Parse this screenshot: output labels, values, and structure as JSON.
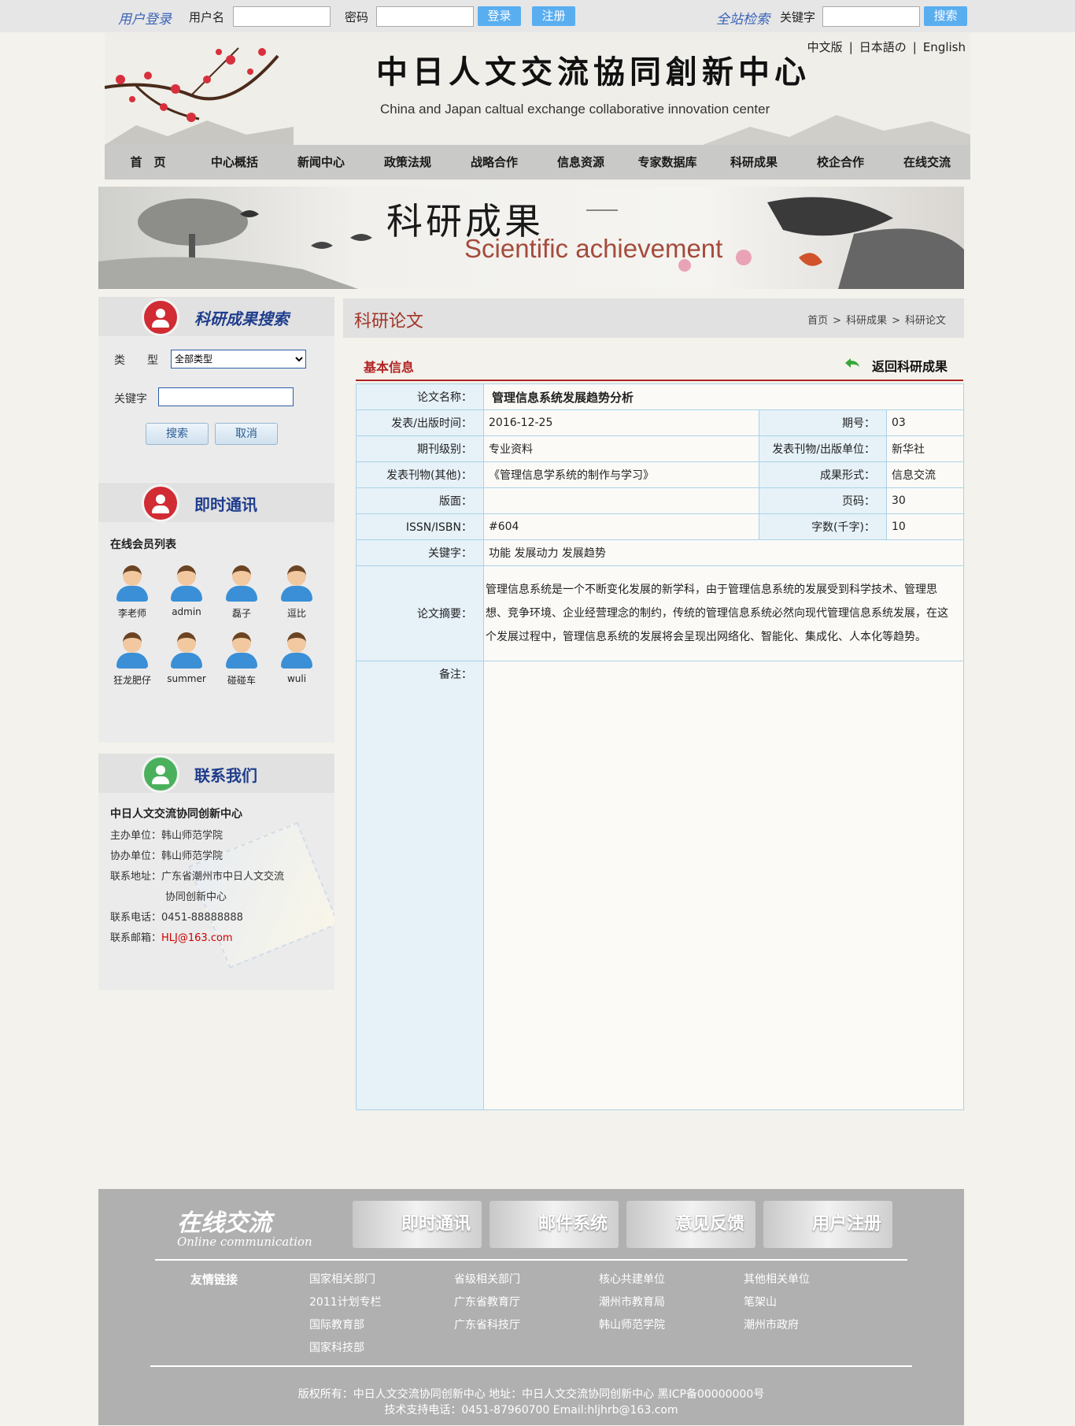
{
  "topbar": {
    "login_title": "用户登录",
    "username_label": "用户名",
    "username_value": "",
    "password_label": "密码",
    "password_value": "",
    "login_btn": "登录",
    "register_btn": "注册",
    "search_title": "全站检索",
    "keyword_label": "关键字",
    "keyword_value": "",
    "search_btn": "搜索"
  },
  "header": {
    "logo_cn": "中日人文交流協同創新中心",
    "logo_en": "China and Japan caltual exchange collaborative innovation center",
    "lang": [
      "中文版",
      "|",
      "日本語の",
      "|",
      "English"
    ]
  },
  "nav": [
    "首　页",
    "中心概括",
    "新闻中心",
    "政策法规",
    "战略合作",
    "信息资源",
    "专家数据库",
    "科研成果",
    "校企合作",
    "在线交流"
  ],
  "banner": {
    "cn": "科研成果",
    "en": "Scientific achievement"
  },
  "search_panel": {
    "title": "科研成果搜索",
    "type_label": "类　　型",
    "type_selected": "全部类型",
    "keyword_label": "关键字",
    "keyword_value": "",
    "search_btn": "搜索",
    "cancel_btn": "取消"
  },
  "im_panel": {
    "title": "即时通讯",
    "list_title": "在线会员列表",
    "members": [
      "李老师",
      "admin",
      "磊子",
      "逗比",
      "狂龙肥仔",
      "summer",
      "碰碰车",
      "wuli"
    ]
  },
  "contact_panel": {
    "title": "联系我们",
    "org": "中日人文交流协同创新中心",
    "host": "主办单位：韩山师范学院",
    "co": "协办单位：韩山师范学院",
    "addr1": "联系地址：广东省潮州市中日人文交流",
    "addr2": "协同创新中心",
    "phone": "联系电话：0451-88888888",
    "email_label": "联系邮箱：",
    "email": "HLJ@163.com"
  },
  "main": {
    "title": "科研论文",
    "breadcrumb": [
      "首页",
      ">",
      "科研成果",
      ">",
      "科研论文"
    ],
    "section_title": "基本信息",
    "back_label": "返回科研成果"
  },
  "detail": {
    "name_k": "论文名称：",
    "name_v": "管理信息系统发展趋势分析",
    "date_k": "发表/出版时间：",
    "date_v": "2016-12-25",
    "issue_k": "期号：",
    "issue_v": "03",
    "level_k": "期刊级别：",
    "level_v": "专业资料",
    "pub_k": "发表刊物/出版单位：",
    "pub_v": "新华社",
    "pub_other_k": "发表刊物(其他)：",
    "pub_other_v": "《管理信息学系统的制作与学习》",
    "form_k": "成果形式：",
    "form_v": "信息交流",
    "layout_k": "版面：",
    "layout_v": "",
    "pages_k": "页码：",
    "pages_v": "30",
    "issn_k": "ISSN/ISBN：",
    "issn_v": "#604",
    "words_k": "字数(千字)：",
    "words_v": "10",
    "kw_k": "关键字：",
    "kw_v": "功能 发展动力 发展趋势",
    "abstract_k": "论文摘要：",
    "abstract_v": "管理信息系统是一个不断变化发展的新学科，由于管理信息系统的发展受到科学技术、管理思想、竞争环境、企业经营理念的制约，传统的管理信息系统必然向现代管理信息系统发展，在这个发展过程中，管理信息系统的发展将会呈现出网络化、智能化、集成化、人本化等趋势。",
    "remark_k": "备注：",
    "remark_v": ""
  },
  "footer": {
    "online_cn": "在线交流",
    "online_en": "Online communication",
    "buttons": [
      "即时通讯",
      "邮件系统",
      "意见反馈",
      "用户注册"
    ],
    "links_label": "友情链接",
    "links": [
      [
        "国家相关部门",
        "2011计划专栏",
        "国际教育部",
        "国家科技部"
      ],
      [
        "省级相关部门",
        "广东省教育厅",
        "广东省科技厅"
      ],
      [
        "核心共建单位",
        "潮州市教育局",
        "韩山师范学院"
      ],
      [
        "其他相关单位",
        "笔架山",
        "潮州市政府"
      ]
    ],
    "copyright": "版权所有：中日人文交流协同创新中心 地址：中日人文交流协同创新中心 黑ICP备00000000号",
    "support": "技术支持电话：0451-87960700 Email:hljhrb@163.com"
  }
}
